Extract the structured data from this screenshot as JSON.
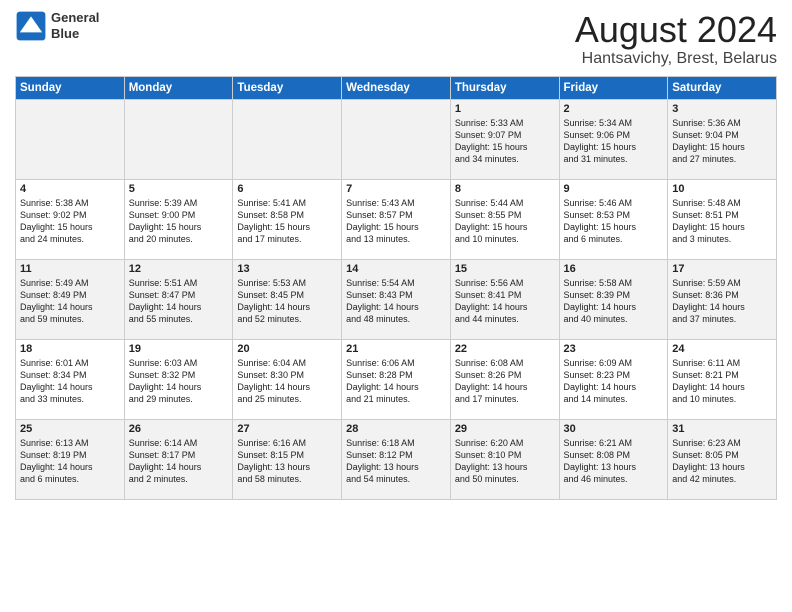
{
  "logo": {
    "line1": "General",
    "line2": "Blue"
  },
  "title": "August 2024",
  "location": "Hantsavichy, Brest, Belarus",
  "days_of_week": [
    "Sunday",
    "Monday",
    "Tuesday",
    "Wednesday",
    "Thursday",
    "Friday",
    "Saturday"
  ],
  "weeks": [
    [
      {
        "day": "",
        "info": ""
      },
      {
        "day": "",
        "info": ""
      },
      {
        "day": "",
        "info": ""
      },
      {
        "day": "",
        "info": ""
      },
      {
        "day": "1",
        "info": "Sunrise: 5:33 AM\nSunset: 9:07 PM\nDaylight: 15 hours\nand 34 minutes."
      },
      {
        "day": "2",
        "info": "Sunrise: 5:34 AM\nSunset: 9:06 PM\nDaylight: 15 hours\nand 31 minutes."
      },
      {
        "day": "3",
        "info": "Sunrise: 5:36 AM\nSunset: 9:04 PM\nDaylight: 15 hours\nand 27 minutes."
      }
    ],
    [
      {
        "day": "4",
        "info": "Sunrise: 5:38 AM\nSunset: 9:02 PM\nDaylight: 15 hours\nand 24 minutes."
      },
      {
        "day": "5",
        "info": "Sunrise: 5:39 AM\nSunset: 9:00 PM\nDaylight: 15 hours\nand 20 minutes."
      },
      {
        "day": "6",
        "info": "Sunrise: 5:41 AM\nSunset: 8:58 PM\nDaylight: 15 hours\nand 17 minutes."
      },
      {
        "day": "7",
        "info": "Sunrise: 5:43 AM\nSunset: 8:57 PM\nDaylight: 15 hours\nand 13 minutes."
      },
      {
        "day": "8",
        "info": "Sunrise: 5:44 AM\nSunset: 8:55 PM\nDaylight: 15 hours\nand 10 minutes."
      },
      {
        "day": "9",
        "info": "Sunrise: 5:46 AM\nSunset: 8:53 PM\nDaylight: 15 hours\nand 6 minutes."
      },
      {
        "day": "10",
        "info": "Sunrise: 5:48 AM\nSunset: 8:51 PM\nDaylight: 15 hours\nand 3 minutes."
      }
    ],
    [
      {
        "day": "11",
        "info": "Sunrise: 5:49 AM\nSunset: 8:49 PM\nDaylight: 14 hours\nand 59 minutes."
      },
      {
        "day": "12",
        "info": "Sunrise: 5:51 AM\nSunset: 8:47 PM\nDaylight: 14 hours\nand 55 minutes."
      },
      {
        "day": "13",
        "info": "Sunrise: 5:53 AM\nSunset: 8:45 PM\nDaylight: 14 hours\nand 52 minutes."
      },
      {
        "day": "14",
        "info": "Sunrise: 5:54 AM\nSunset: 8:43 PM\nDaylight: 14 hours\nand 48 minutes."
      },
      {
        "day": "15",
        "info": "Sunrise: 5:56 AM\nSunset: 8:41 PM\nDaylight: 14 hours\nand 44 minutes."
      },
      {
        "day": "16",
        "info": "Sunrise: 5:58 AM\nSunset: 8:39 PM\nDaylight: 14 hours\nand 40 minutes."
      },
      {
        "day": "17",
        "info": "Sunrise: 5:59 AM\nSunset: 8:36 PM\nDaylight: 14 hours\nand 37 minutes."
      }
    ],
    [
      {
        "day": "18",
        "info": "Sunrise: 6:01 AM\nSunset: 8:34 PM\nDaylight: 14 hours\nand 33 minutes."
      },
      {
        "day": "19",
        "info": "Sunrise: 6:03 AM\nSunset: 8:32 PM\nDaylight: 14 hours\nand 29 minutes."
      },
      {
        "day": "20",
        "info": "Sunrise: 6:04 AM\nSunset: 8:30 PM\nDaylight: 14 hours\nand 25 minutes."
      },
      {
        "day": "21",
        "info": "Sunrise: 6:06 AM\nSunset: 8:28 PM\nDaylight: 14 hours\nand 21 minutes."
      },
      {
        "day": "22",
        "info": "Sunrise: 6:08 AM\nSunset: 8:26 PM\nDaylight: 14 hours\nand 17 minutes."
      },
      {
        "day": "23",
        "info": "Sunrise: 6:09 AM\nSunset: 8:23 PM\nDaylight: 14 hours\nand 14 minutes."
      },
      {
        "day": "24",
        "info": "Sunrise: 6:11 AM\nSunset: 8:21 PM\nDaylight: 14 hours\nand 10 minutes."
      }
    ],
    [
      {
        "day": "25",
        "info": "Sunrise: 6:13 AM\nSunset: 8:19 PM\nDaylight: 14 hours\nand 6 minutes."
      },
      {
        "day": "26",
        "info": "Sunrise: 6:14 AM\nSunset: 8:17 PM\nDaylight: 14 hours\nand 2 minutes."
      },
      {
        "day": "27",
        "info": "Sunrise: 6:16 AM\nSunset: 8:15 PM\nDaylight: 13 hours\nand 58 minutes."
      },
      {
        "day": "28",
        "info": "Sunrise: 6:18 AM\nSunset: 8:12 PM\nDaylight: 13 hours\nand 54 minutes."
      },
      {
        "day": "29",
        "info": "Sunrise: 6:20 AM\nSunset: 8:10 PM\nDaylight: 13 hours\nand 50 minutes."
      },
      {
        "day": "30",
        "info": "Sunrise: 6:21 AM\nSunset: 8:08 PM\nDaylight: 13 hours\nand 46 minutes."
      },
      {
        "day": "31",
        "info": "Sunrise: 6:23 AM\nSunset: 8:05 PM\nDaylight: 13 hours\nand 42 minutes."
      }
    ]
  ]
}
